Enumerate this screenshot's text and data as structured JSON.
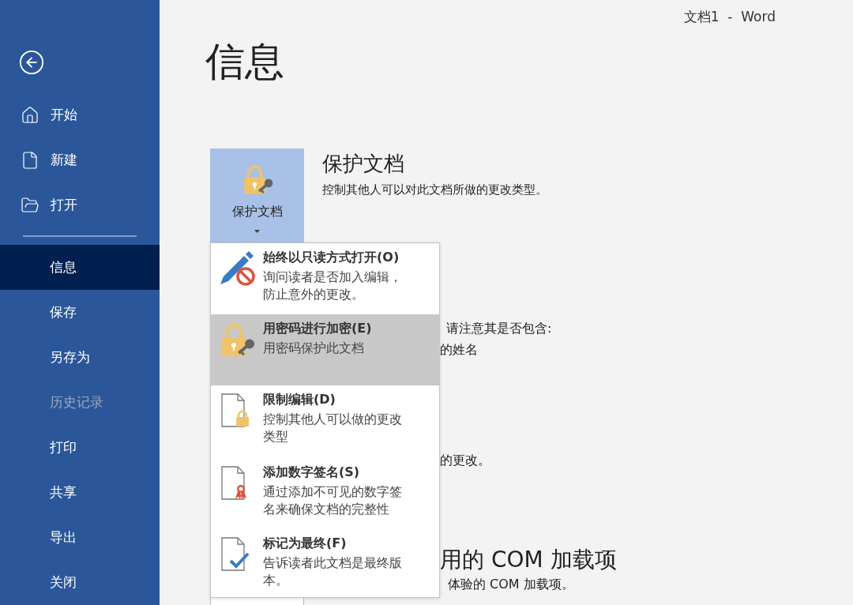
{
  "window": {
    "title": "文档1  -  Word"
  },
  "sidebar": {
    "items": [
      {
        "label": "开始",
        "selected": false,
        "disabled": false
      },
      {
        "label": "新建",
        "selected": false,
        "disabled": false
      },
      {
        "label": "打开",
        "selected": false,
        "disabled": false
      },
      {
        "label": "信息",
        "selected": true,
        "disabled": false
      },
      {
        "label": "保存",
        "selected": false,
        "disabled": false
      },
      {
        "label": "另存为",
        "selected": false,
        "disabled": false
      },
      {
        "label": "历史记录",
        "selected": false,
        "disabled": true
      },
      {
        "label": "打印",
        "selected": false,
        "disabled": false
      },
      {
        "label": "共享",
        "selected": false,
        "disabled": false
      },
      {
        "label": "导出",
        "selected": false,
        "disabled": false
      },
      {
        "label": "关闭",
        "selected": false,
        "disabled": false
      }
    ]
  },
  "heading": "信息",
  "protect": {
    "button_label": "保护文档",
    "title": "保护文档",
    "description": "控制其他人可以对此文档所做的更改类型。"
  },
  "behind": {
    "inspect_note": "请注意其是否包含:",
    "author_fragment": "的姓名",
    "changes_fragment": "的更改。",
    "com_heading": "用的 COM 加载项",
    "com_description": "体验的 COM 加载项。"
  },
  "menu": {
    "items": [
      {
        "kind": "readonly",
        "title": "始终以只读方式打开(O)",
        "description": "询问读者是否加入编辑，防止意外的更改。",
        "selected": false
      },
      {
        "kind": "encrypt",
        "title": "用密码进行加密(E)",
        "description": "用密码保护此文档",
        "selected": true
      },
      {
        "kind": "restrict",
        "title": "限制编辑(D)",
        "description": "控制其他人可以做的更改类型",
        "selected": false
      },
      {
        "kind": "signature",
        "title": "添加数字签名(S)",
        "description": "通过添加不可见的数字签名来确保文档的完整性",
        "selected": false
      },
      {
        "kind": "final",
        "title": "标记为最终(F)",
        "description": "告诉读者此文档是最终版本。",
        "selected": false
      }
    ]
  }
}
